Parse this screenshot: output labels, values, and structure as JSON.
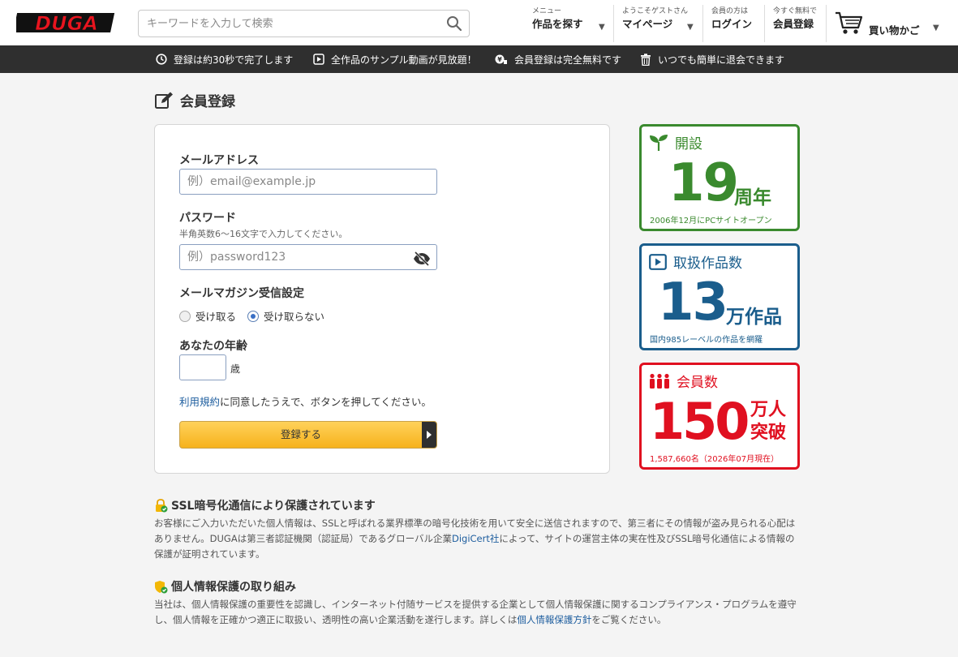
{
  "header": {
    "logo_text": "DUGA",
    "search_placeholder": "キーワードを入力して検索",
    "nav": [
      {
        "small": "メニュー",
        "label": "作品を探す"
      },
      {
        "small": "ようこそゲストさん",
        "label": "マイページ"
      },
      {
        "small": "会員の方は",
        "label": "ログイン"
      },
      {
        "small": "今すぐ無料で",
        "label": "会員登録"
      }
    ],
    "cart_label": "買い物かご"
  },
  "infobar": [
    {
      "icon": "clock-icon",
      "text": "登録は約30秒で完了します"
    },
    {
      "icon": "play-icon",
      "text": "全作品のサンプル動画が見放題！"
    },
    {
      "icon": "yen-icon",
      "text": "会員登録は完全無料です"
    },
    {
      "icon": "trash-icon",
      "text": "いつでも簡単に退会できます"
    }
  ],
  "page_title": "会員登録",
  "form": {
    "email_label": "メールアドレス",
    "email_placeholder": "例）email@example.jp",
    "password_label": "パスワード",
    "password_note": "半角英数6〜16文字で入力してください。",
    "password_placeholder": "例）password123",
    "magazine_label": "メールマガジン受信設定",
    "magazine_options": [
      "受け取る",
      "受け取らない"
    ],
    "magazine_selected": "受け取らない",
    "age_label": "あなたの年齢",
    "age_unit": "歳",
    "terms_link": "利用規約",
    "terms_text": "に同意したうえで、ボタンを押してください。",
    "submit_label": "登録する"
  },
  "stats": [
    {
      "icon": "sprout-icon",
      "title": "開設",
      "number": "19",
      "unit": "周年",
      "sub": "2006年12月にPCサイトオープン",
      "color": "#3a8a2e"
    },
    {
      "icon": "video-icon",
      "title": "取扱作品数",
      "number": "13",
      "unit": "万作品",
      "sub": "国内985レーベルの作品を網羅",
      "color": "#1a5d8c"
    },
    {
      "icon": "people-icon",
      "title": "会員数",
      "number": "150",
      "unit_line1": "万人",
      "unit_line2": "突破",
      "sub": "1,587,660名（2026年07月現在）",
      "color": "#e01020"
    }
  ],
  "ssl": {
    "title": "SSL暗号化通信により保護されています",
    "body_1": "お客様にご入力いただいた個人情報は、SSLと呼ばれる業界標準の暗号化技術を用いて安全に送信されますので、第三者にその情報が盗み見られる心配はありません。DUGAは第三者認証機関（認証局）であるグローバル企業",
    "link": "DigiCert社",
    "body_2": "によって、サイトの運営主体の実在性及びSSL暗号化通信による情報の保護が証明されています。"
  },
  "privacy": {
    "title": "個人情報保護の取り組み",
    "body_1": "当社は、個人情報保護の重要性を認識し、インターネット付随サービスを提供する企業として個人情報保護に関するコンプライアンス・プログラムを遵守し、個人情報を正確かつ適正に取扱い、透明性の高い企業活動を遂行します。詳しくは",
    "link": "個人情報保護方針",
    "body_2": "をご覧ください。"
  }
}
